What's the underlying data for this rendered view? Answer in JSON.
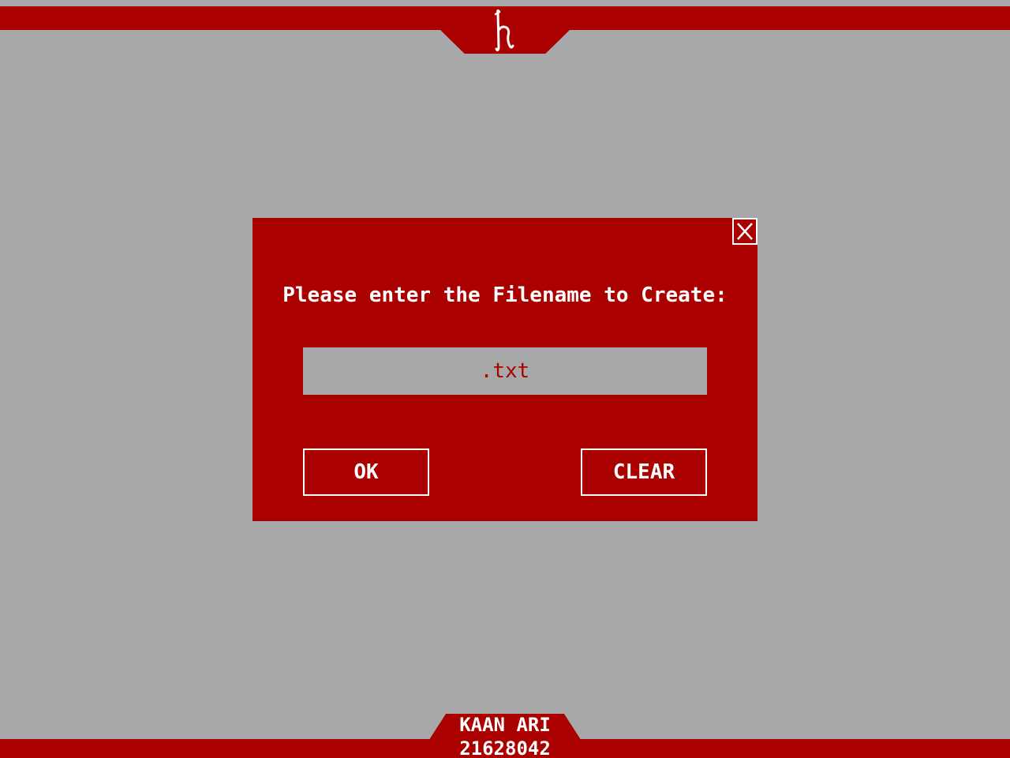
{
  "colors": {
    "accent": "#aa0000",
    "background": "#a8a8a8",
    "text_light": "#ffffff"
  },
  "header": {
    "logo_icon": "stylized-h-logo-icon"
  },
  "dialog": {
    "prompt": "Please enter the Filename to Create:",
    "filename_value": ".txt",
    "close_icon": "close-icon",
    "ok_label": "OK",
    "clear_label": "CLEAR"
  },
  "footer": {
    "name": "KAAN ARI",
    "id": "21628042"
  }
}
